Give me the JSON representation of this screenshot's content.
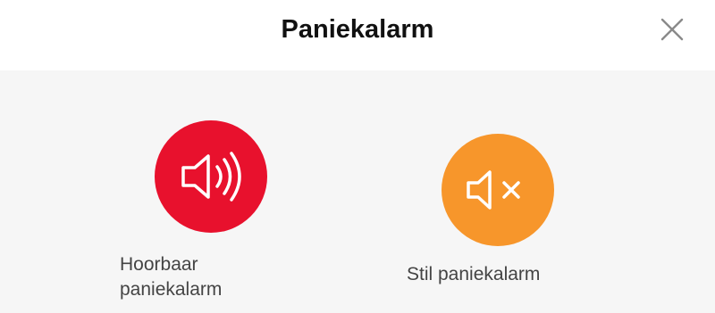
{
  "header": {
    "title": "Paniekalarm",
    "close_icon": "close-icon"
  },
  "options": [
    {
      "label_line1": "Hoorbaar",
      "label_line2": "paniekalarm",
      "icon": "speaker-sound-icon",
      "color": "#e8112d"
    },
    {
      "label": "Stil paniekalarm",
      "icon": "speaker-mute-icon",
      "color": "#f7962b"
    }
  ]
}
